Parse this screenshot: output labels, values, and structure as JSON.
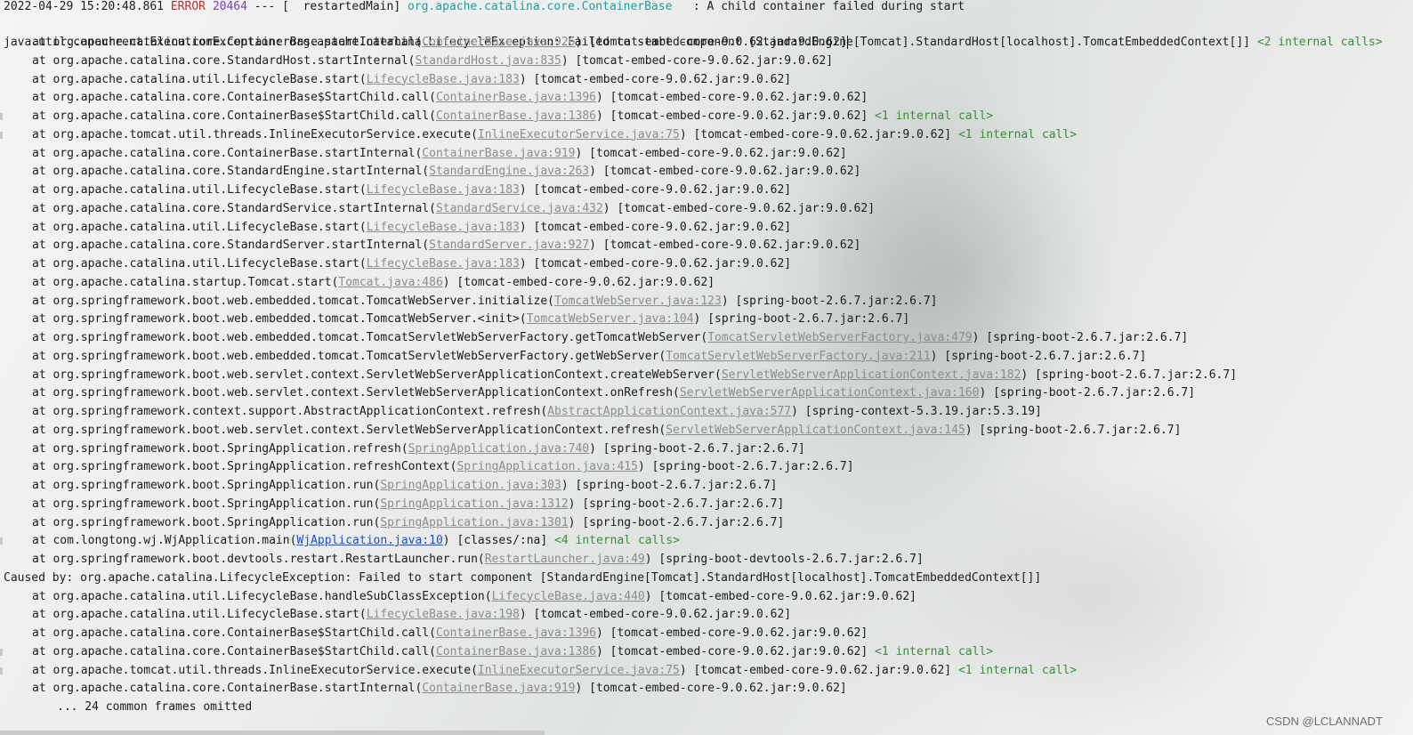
{
  "header": {
    "timestamp": "2022-04-29 15:20:48.861",
    "level": "ERROR",
    "pid": "20464",
    "separator": "--- [",
    "thread": "  restartedMain]",
    "logger": "org.apache.catalina.core.ContainerBase",
    "message": "   : A child container failed during start"
  },
  "exception": {
    "text": "java.util.concurrent.ExecutionException: org.apache.catalina.LifecycleException: Failed to start component [StandardEngine[Tomcat].StandardHost[localhost].TomcatEmbeddedContext[]]",
    "internal": "<2 internal calls>"
  },
  "frames": [
    {
      "method": "at org.apache.catalina.core.ContainerBase.startInternal(",
      "link": "ContainerBase.java:926",
      "tail": ") [tomcat-embed-core-9.0.62.jar:9.0.62]",
      "internal": ""
    },
    {
      "method": "at org.apache.catalina.core.StandardHost.startInternal(",
      "link": "StandardHost.java:835",
      "tail": ") [tomcat-embed-core-9.0.62.jar:9.0.62]",
      "internal": ""
    },
    {
      "method": "at org.apache.catalina.util.LifecycleBase.start(",
      "link": "LifecycleBase.java:183",
      "tail": ") [tomcat-embed-core-9.0.62.jar:9.0.62]",
      "internal": ""
    },
    {
      "method": "at org.apache.catalina.core.ContainerBase$StartChild.call(",
      "link": "ContainerBase.java:1396",
      "tail": ") [tomcat-embed-core-9.0.62.jar:9.0.62]",
      "internal": ""
    },
    {
      "method": "at org.apache.catalina.core.ContainerBase$StartChild.call(",
      "link": "ContainerBase.java:1386",
      "tail": ") [tomcat-embed-core-9.0.62.jar:9.0.62]",
      "internal": "<1 internal call>"
    },
    {
      "method": "at org.apache.tomcat.util.threads.InlineExecutorService.execute(",
      "link": "InlineExecutorService.java:75",
      "tail": ") [tomcat-embed-core-9.0.62.jar:9.0.62]",
      "internal": "<1 internal call>"
    },
    {
      "method": "at org.apache.catalina.core.ContainerBase.startInternal(",
      "link": "ContainerBase.java:919",
      "tail": ") [tomcat-embed-core-9.0.62.jar:9.0.62]",
      "internal": ""
    },
    {
      "method": "at org.apache.catalina.core.StandardEngine.startInternal(",
      "link": "StandardEngine.java:263",
      "tail": ") [tomcat-embed-core-9.0.62.jar:9.0.62]",
      "internal": ""
    },
    {
      "method": "at org.apache.catalina.util.LifecycleBase.start(",
      "link": "LifecycleBase.java:183",
      "tail": ") [tomcat-embed-core-9.0.62.jar:9.0.62]",
      "internal": ""
    },
    {
      "method": "at org.apache.catalina.core.StandardService.startInternal(",
      "link": "StandardService.java:432",
      "tail": ") [tomcat-embed-core-9.0.62.jar:9.0.62]",
      "internal": ""
    },
    {
      "method": "at org.apache.catalina.util.LifecycleBase.start(",
      "link": "LifecycleBase.java:183",
      "tail": ") [tomcat-embed-core-9.0.62.jar:9.0.62]",
      "internal": ""
    },
    {
      "method": "at org.apache.catalina.core.StandardServer.startInternal(",
      "link": "StandardServer.java:927",
      "tail": ") [tomcat-embed-core-9.0.62.jar:9.0.62]",
      "internal": ""
    },
    {
      "method": "at org.apache.catalina.util.LifecycleBase.start(",
      "link": "LifecycleBase.java:183",
      "tail": ") [tomcat-embed-core-9.0.62.jar:9.0.62]",
      "internal": ""
    },
    {
      "method": "at org.apache.catalina.startup.Tomcat.start(",
      "link": "Tomcat.java:486",
      "tail": ") [tomcat-embed-core-9.0.62.jar:9.0.62]",
      "internal": ""
    },
    {
      "method": "at org.springframework.boot.web.embedded.tomcat.TomcatWebServer.initialize(",
      "link": "TomcatWebServer.java:123",
      "tail": ") [spring-boot-2.6.7.jar:2.6.7]",
      "internal": ""
    },
    {
      "method": "at org.springframework.boot.web.embedded.tomcat.TomcatWebServer.<init>(",
      "link": "TomcatWebServer.java:104",
      "tail": ") [spring-boot-2.6.7.jar:2.6.7]",
      "internal": ""
    },
    {
      "method": "at org.springframework.boot.web.embedded.tomcat.TomcatServletWebServerFactory.getTomcatWebServer(",
      "link": "TomcatServletWebServerFactory.java:479",
      "tail": ") [spring-boot-2.6.7.jar:2.6.7]",
      "internal": ""
    },
    {
      "method": "at org.springframework.boot.web.embedded.tomcat.TomcatServletWebServerFactory.getWebServer(",
      "link": "TomcatServletWebServerFactory.java:211",
      "tail": ") [spring-boot-2.6.7.jar:2.6.7]",
      "internal": ""
    },
    {
      "method": "at org.springframework.boot.web.servlet.context.ServletWebServerApplicationContext.createWebServer(",
      "link": "ServletWebServerApplicationContext.java:182",
      "tail": ") [spring-boot-2.6.7.jar:2.6.7]",
      "internal": ""
    },
    {
      "method": "at org.springframework.boot.web.servlet.context.ServletWebServerApplicationContext.onRefresh(",
      "link": "ServletWebServerApplicationContext.java:160",
      "tail": ") [spring-boot-2.6.7.jar:2.6.7]",
      "internal": ""
    },
    {
      "method": "at org.springframework.context.support.AbstractApplicationContext.refresh(",
      "link": "AbstractApplicationContext.java:577",
      "tail": ") [spring-context-5.3.19.jar:5.3.19]",
      "internal": ""
    },
    {
      "method": "at org.springframework.boot.web.servlet.context.ServletWebServerApplicationContext.refresh(",
      "link": "ServletWebServerApplicationContext.java:145",
      "tail": ") [spring-boot-2.6.7.jar:2.6.7]",
      "internal": ""
    },
    {
      "method": "at org.springframework.boot.SpringApplication.refresh(",
      "link": "SpringApplication.java:740",
      "tail": ") [spring-boot-2.6.7.jar:2.6.7]",
      "internal": ""
    },
    {
      "method": "at org.springframework.boot.SpringApplication.refreshContext(",
      "link": "SpringApplication.java:415",
      "tail": ") [spring-boot-2.6.7.jar:2.6.7]",
      "internal": ""
    },
    {
      "method": "at org.springframework.boot.SpringApplication.run(",
      "link": "SpringApplication.java:303",
      "tail": ") [spring-boot-2.6.7.jar:2.6.7]",
      "internal": ""
    },
    {
      "method": "at org.springframework.boot.SpringApplication.run(",
      "link": "SpringApplication.java:1312",
      "tail": ") [spring-boot-2.6.7.jar:2.6.7]",
      "internal": ""
    },
    {
      "method": "at org.springframework.boot.SpringApplication.run(",
      "link": "SpringApplication.java:1301",
      "tail": ") [spring-boot-2.6.7.jar:2.6.7]",
      "internal": ""
    },
    {
      "method": "at com.longtong.wj.WjApplication.main(",
      "link": "WjApplication.java:10",
      "tail": ") [classes/:na]",
      "internal": "<4 internal calls>",
      "own": true
    },
    {
      "method": "at org.springframework.boot.devtools.restart.RestartLauncher.run(",
      "link": "RestartLauncher.java:49",
      "tail": ") [spring-boot-devtools-2.6.7.jar:2.6.7]",
      "internal": ""
    }
  ],
  "caused_by": {
    "text": "Caused by: org.apache.catalina.LifecycleException: Failed to start component [StandardEngine[Tomcat].StandardHost[localhost].TomcatEmbeddedContext[]]"
  },
  "caused_frames": [
    {
      "method": "at org.apache.catalina.util.LifecycleBase.handleSubClassException(",
      "link": "LifecycleBase.java:440",
      "tail": ") [tomcat-embed-core-9.0.62.jar:9.0.62]",
      "internal": ""
    },
    {
      "method": "at org.apache.catalina.util.LifecycleBase.start(",
      "link": "LifecycleBase.java:198",
      "tail": ") [tomcat-embed-core-9.0.62.jar:9.0.62]",
      "internal": ""
    },
    {
      "method": "at org.apache.catalina.core.ContainerBase$StartChild.call(",
      "link": "ContainerBase.java:1396",
      "tail": ") [tomcat-embed-core-9.0.62.jar:9.0.62]",
      "internal": ""
    },
    {
      "method": "at org.apache.catalina.core.ContainerBase$StartChild.call(",
      "link": "ContainerBase.java:1386",
      "tail": ") [tomcat-embed-core-9.0.62.jar:9.0.62]",
      "internal": "<1 internal call>"
    },
    {
      "method": "at org.apache.tomcat.util.threads.InlineExecutorService.execute(",
      "link": "InlineExecutorService.java:75",
      "tail": ") [tomcat-embed-core-9.0.62.jar:9.0.62]",
      "internal": "<1 internal call>"
    },
    {
      "method": "at org.apache.catalina.core.ContainerBase.startInternal(",
      "link": "ContainerBase.java:919",
      "tail": ") [tomcat-embed-core-9.0.62.jar:9.0.62]",
      "internal": ""
    }
  ],
  "footer": {
    "omitted": "... 24 common frames omitted",
    "watermark": "CSDN @LCLANNADT"
  },
  "colors": {
    "error": "#c42b2b",
    "pid": "#7a3fb5",
    "logger": "#1f9e9e",
    "internal_calls": "#3a8d3a",
    "source_link": "#8c8c8c",
    "user_link": "#1a4fd6"
  }
}
